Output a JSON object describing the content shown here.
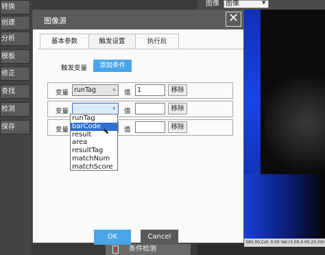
{
  "sidebar": {
    "items": [
      {
        "label": "转换"
      },
      {
        "label": "创建"
      },
      {
        "label": "分析"
      },
      {
        "label": "模板"
      },
      {
        "label": "修正"
      },
      {
        "label": "查找"
      },
      {
        "label": "检测"
      },
      {
        "label": "保存"
      }
    ]
  },
  "image_panel": {
    "label": "图像",
    "select_value": "图像",
    "status_text": "385.00,Col: 0.00  Val:(3.00,4.00,25.00)"
  },
  "bottom_toolbar": {
    "button_label": "条件检测"
  },
  "dialog": {
    "title": "图像源",
    "tabs": [
      {
        "label": "基本参数"
      },
      {
        "label": "触发设置"
      },
      {
        "label": "执行后"
      }
    ],
    "active_tab": "触发设置",
    "trigger_label": "触发变量",
    "add_button": "添加条件",
    "rows": [
      {
        "label": "变量",
        "variable": "runTag",
        "value_label": "值",
        "value": "1",
        "remove": "移除"
      },
      {
        "label": "变量",
        "variable": "",
        "value_label": "值",
        "value": "",
        "remove": "移除"
      },
      {
        "label": "变量",
        "variable": "",
        "value_label": "值",
        "value": "",
        "remove": "移除"
      }
    ],
    "dropdown_options": [
      "runTag",
      "barCode",
      "result",
      "area",
      "resultTag",
      "matchNum",
      "matchScore"
    ],
    "dropdown_selected": "barCode",
    "ok": "OK",
    "cancel": "Cancel"
  },
  "colors": {
    "accent": "#48a5e8",
    "selection": "#2d6fd2",
    "title_bar": "#5b5b5b"
  }
}
